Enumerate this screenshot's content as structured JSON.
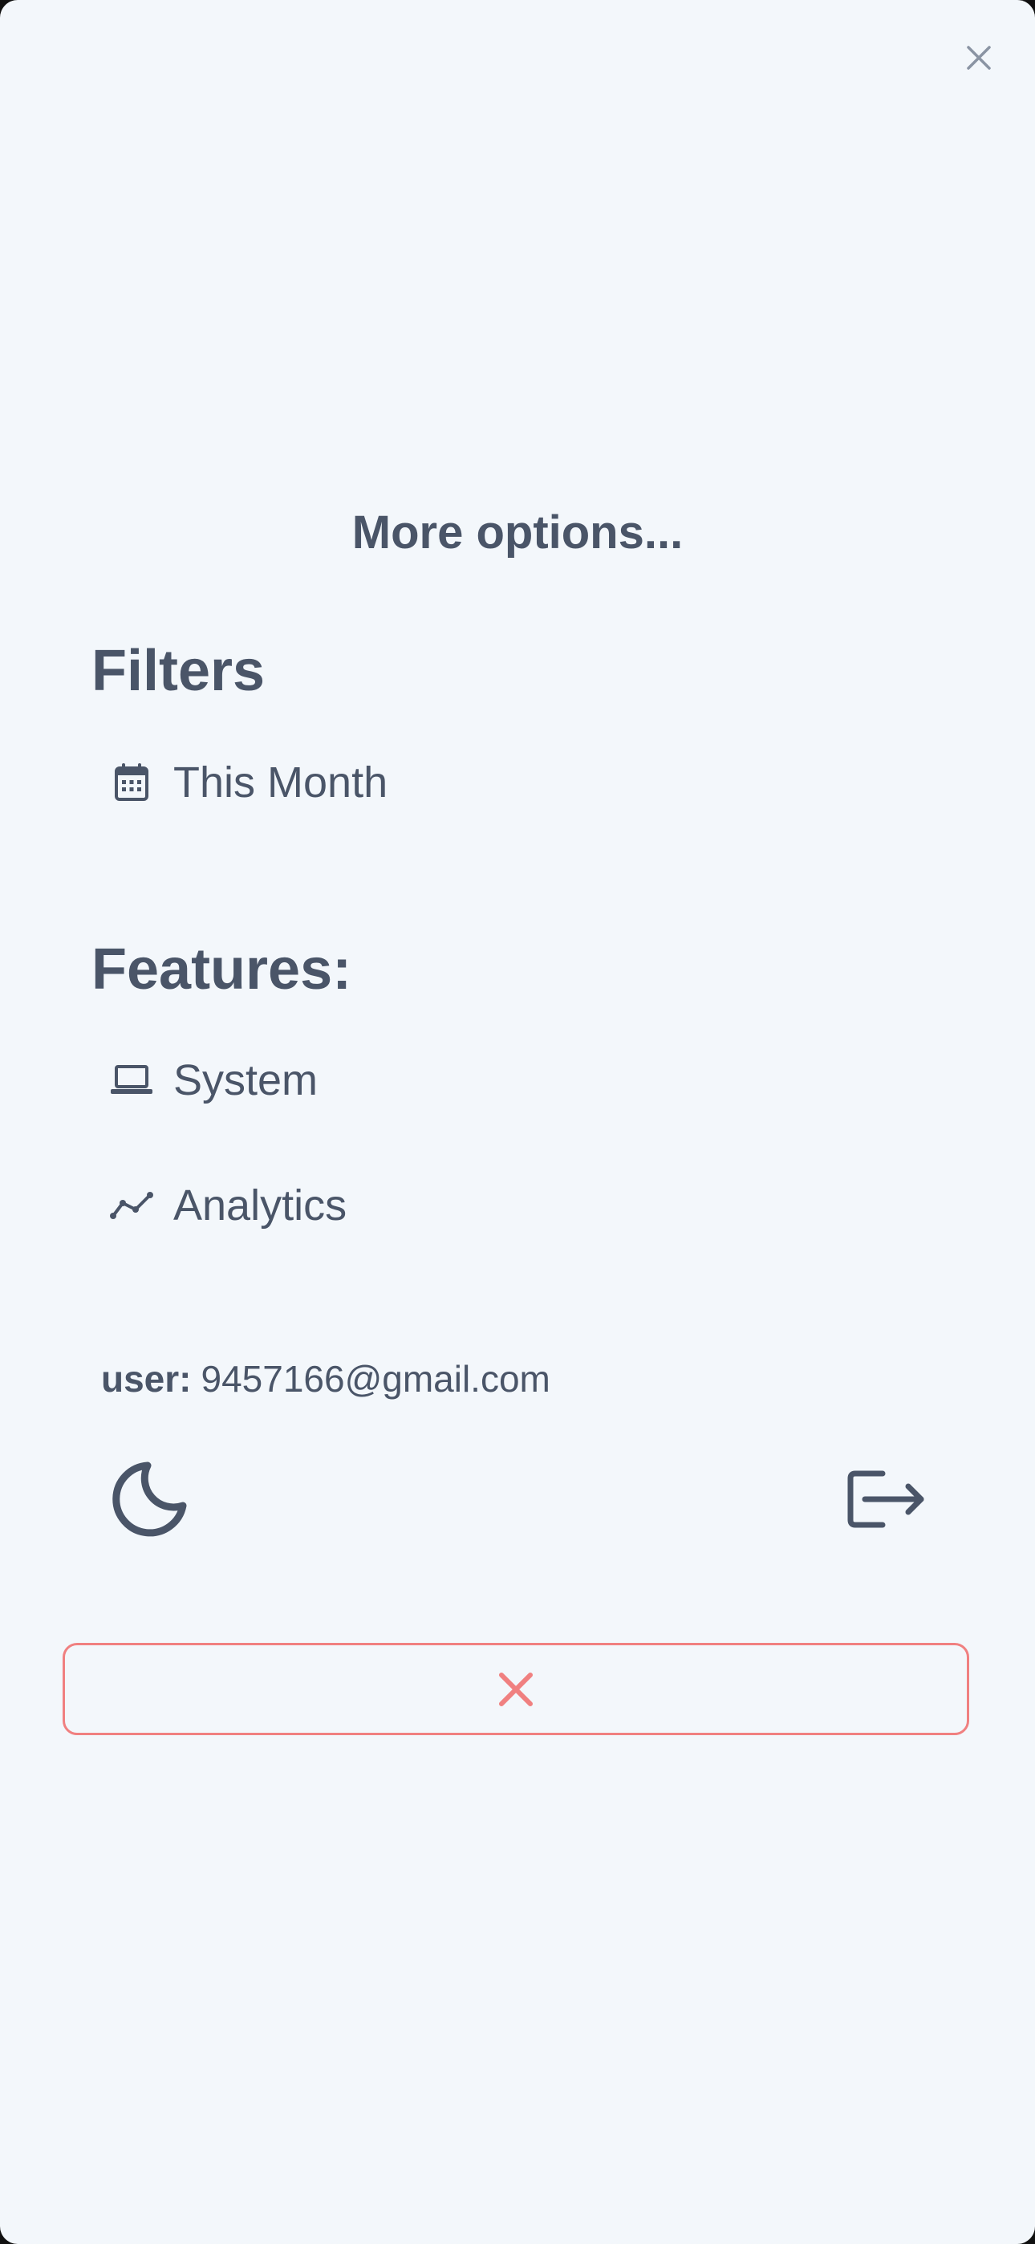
{
  "menu": {
    "title": "More options..."
  },
  "filters": {
    "heading": "Filters",
    "items": [
      {
        "label": "This Month",
        "icon": "calendar-icon"
      }
    ]
  },
  "features": {
    "heading": "Features:",
    "items": [
      {
        "label": "System",
        "icon": "laptop-icon"
      },
      {
        "label": "Analytics",
        "icon": "trend-line-icon"
      }
    ]
  },
  "user": {
    "key": "user:",
    "email": "9457166@gmail.com"
  },
  "icons": {
    "top_close": "close-icon",
    "theme": "moon-icon",
    "logout": "logout-icon",
    "bottom_close": "close-icon"
  },
  "colors": {
    "background": "#f3f7fb",
    "text": "#4a5568",
    "danger": "#f08080"
  }
}
